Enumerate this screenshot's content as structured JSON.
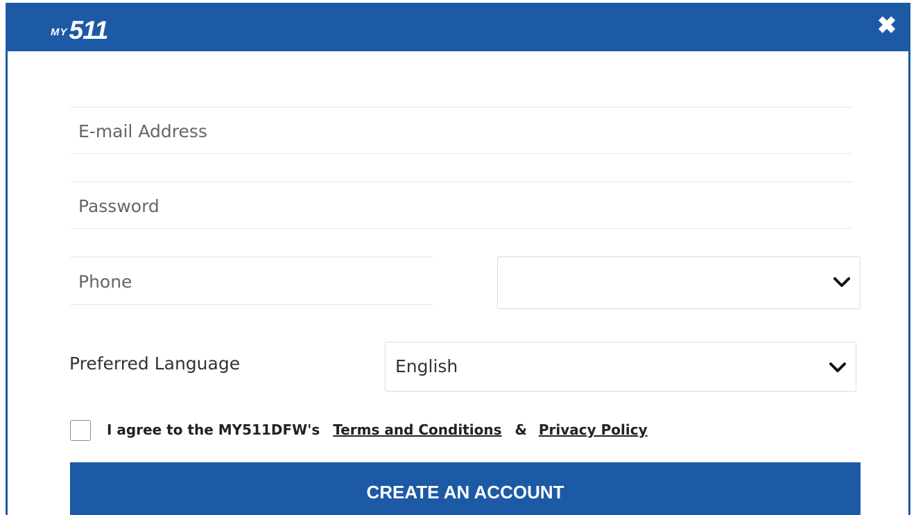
{
  "header": {
    "logo_prefix": "MY",
    "logo_number": "511",
    "close_label": "✖"
  },
  "form": {
    "email": {
      "placeholder": "E-mail Address",
      "value": ""
    },
    "password": {
      "placeholder": "Password",
      "value": ""
    },
    "phone": {
      "placeholder": "Phone",
      "value": ""
    },
    "phone_carrier": {
      "selected": ""
    },
    "language": {
      "label": "Preferred Language",
      "selected": "English"
    },
    "agree": {
      "text": "I agree to the MY511DFW's",
      "terms_link": "Terms and Conditions",
      "ampersand": "&",
      "privacy_link": "Privacy Policy",
      "checked": false
    },
    "submit_label": "CREATE AN ACCOUNT"
  },
  "colors": {
    "brand_blue": "#1d5aa5",
    "white": "#ffffff"
  },
  "icons": {
    "close": "close-icon",
    "chevron": "chevron-down-icon"
  }
}
